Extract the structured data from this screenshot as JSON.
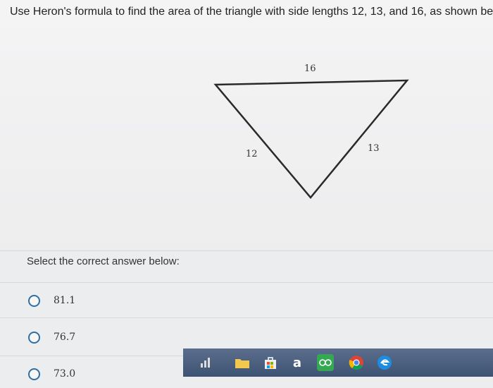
{
  "question": {
    "text": "Use Heron's formula to find the area of the triangle with side lengths 12, 13, and 16, as shown below."
  },
  "figure": {
    "side_top": "16",
    "side_left": "12",
    "side_right": "13"
  },
  "answers": {
    "prompt": "Select the correct answer below:",
    "choices": [
      "81.1",
      "76.7",
      "73.0"
    ]
  },
  "taskbar": {
    "amazon_letter": "a"
  },
  "colors": {
    "radio_border": "#2f6fa3",
    "taskbar": "#4a5d7e"
  }
}
